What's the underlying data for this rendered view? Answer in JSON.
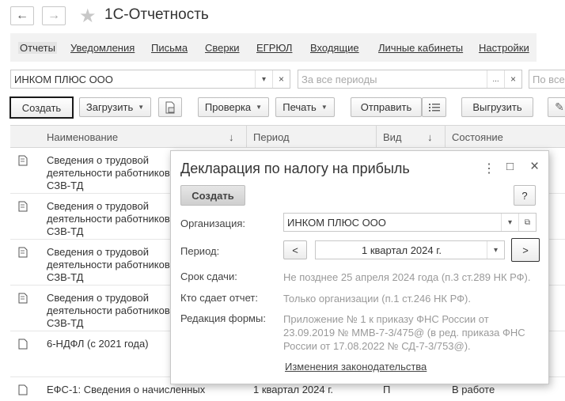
{
  "app": {
    "title": "1С-Отчетность",
    "back_glyph": "←",
    "forward_glyph": "→",
    "star_glyph": "★"
  },
  "sections": [
    "Отчеты",
    "Уведомления",
    "Письма",
    "Сверки",
    "ЕГРЮЛ",
    "Входящие",
    "Личные кабинеты",
    "Настройки"
  ],
  "filters": {
    "organization_value": "ИНКОМ ПЛЮС ООО",
    "period_placeholder": "За все периоды",
    "type_placeholder": "По все",
    "dots": "...",
    "clear": "×"
  },
  "toolbar": {
    "create": "Создать",
    "load": "Загрузить",
    "check": "Проверка",
    "print": "Печать",
    "send": "Отправить",
    "export": "Выгрузить"
  },
  "table": {
    "headers": {
      "name": "Наименование",
      "period": "Период",
      "kind": "Вид",
      "status": "Состояние"
    },
    "sort_glyph": "↓",
    "rows": [
      {
        "name": "Сведения о трудовой деятельности работников, СЗВ-ТД",
        "period": "",
        "kind": "",
        "status": ""
      },
      {
        "name": "Сведения о трудовой деятельности работников, СЗВ-ТД",
        "period": "",
        "kind": "",
        "status": ""
      },
      {
        "name": "Сведения о трудовой деятельности работников, СЗВ-ТД",
        "period": "",
        "kind": "",
        "status": ""
      },
      {
        "name": "Сведения о трудовой деятельности работников, СЗВ-ТД",
        "period": "",
        "kind": "",
        "status": ""
      },
      {
        "name": "6-НДФЛ (с 2021 года)",
        "period": "",
        "kind": "",
        "status": ""
      },
      {
        "name": "ЕФС-1: Сведения о начисленных",
        "period": "1 квартал 2024 г.",
        "kind": "П",
        "status": "В работе"
      }
    ]
  },
  "dialog": {
    "title": "Декларация по налогу на прибыль",
    "create_button": "Создать",
    "help_button": "?",
    "organization_label": "Организация:",
    "organization_value": "ИНКОМ ПЛЮС ООО",
    "period_label": "Период:",
    "period_value": "1 квартал 2024 г.",
    "deadline_label": "Срок сдачи:",
    "deadline_value": "Не позднее 25 апреля 2024 года (п.3 ст.289 НК РФ).",
    "submitter_label": "Кто сдает отчет:",
    "submitter_value": "Только организации (п.1 ст.246 НК РФ).",
    "form_label": "Редакция формы:",
    "form_value": "Приложение № 1 к приказу ФНС России от 23.09.2019 № ММВ-7-3/475@ (в ред. приказа ФНС России от 17.08.2022 № СД-7-3/753@).",
    "law_changes_link": "Изменения законодательства",
    "menu_glyph": "⋮",
    "maximize_glyph": "□",
    "close_glyph": "×",
    "prev_glyph": "<",
    "next_glyph": ">"
  }
}
